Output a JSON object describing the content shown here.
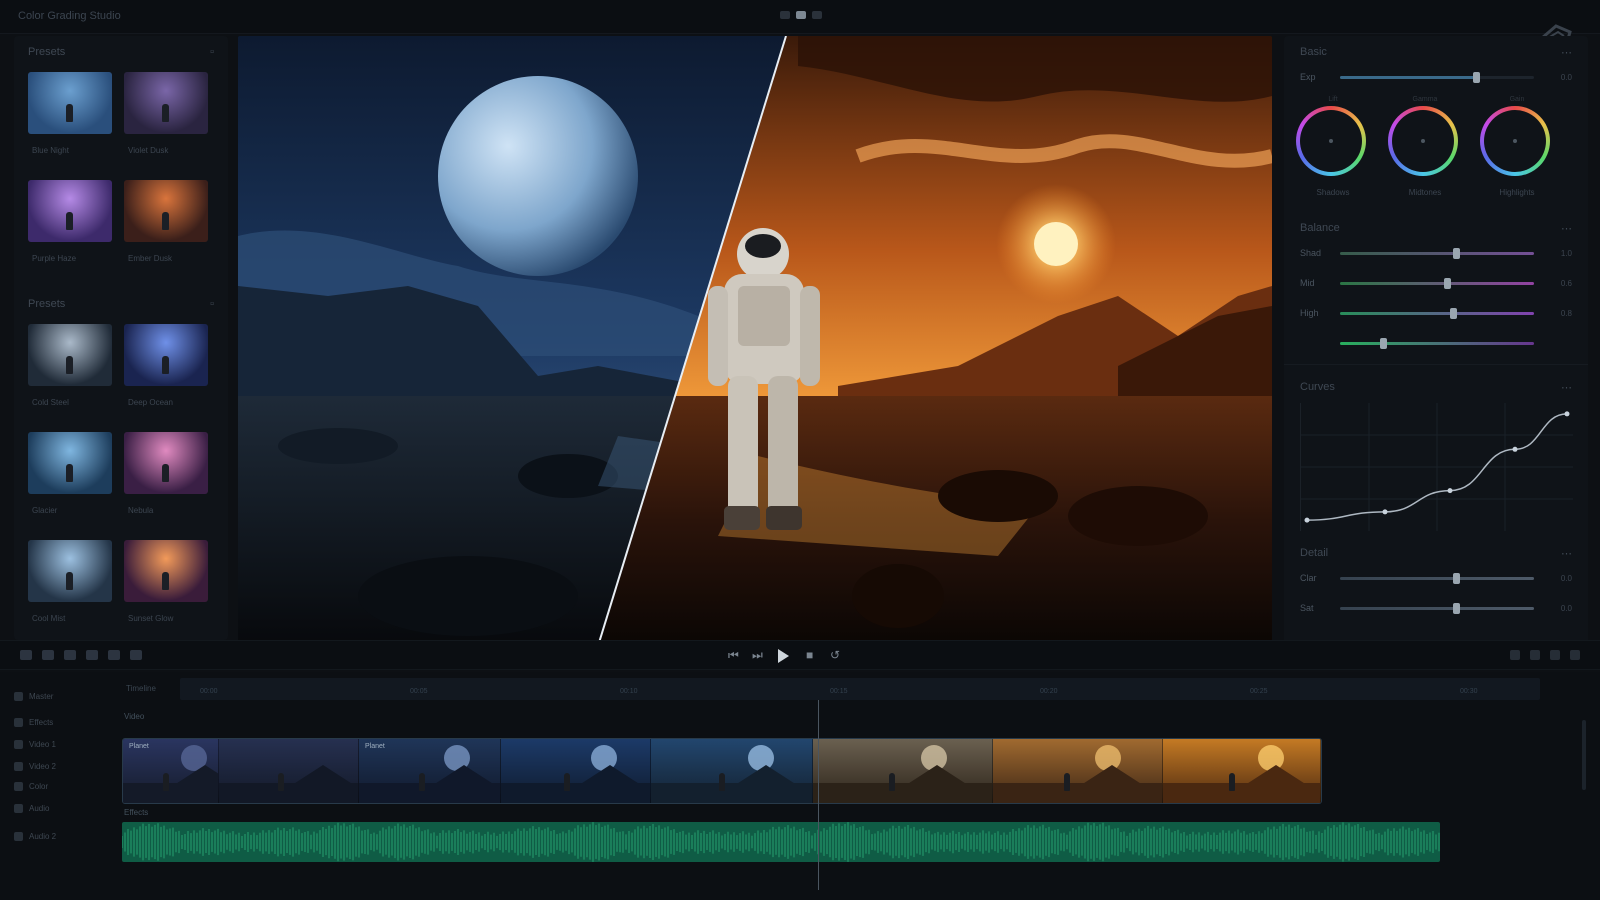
{
  "app": {
    "title": "Color Grading Studio",
    "view_modes": [
      "compare-split",
      "single",
      "side"
    ]
  },
  "left_panel": {
    "section1_title": "Presets",
    "section2_title": "Presets",
    "presets_top": [
      {
        "label": "Blue Night",
        "tint_a": "#2a4f7c",
        "tint_b": "#6b9fcf"
      },
      {
        "label": "Violet Dusk",
        "tint_a": "#2a2440",
        "tint_b": "#7a66a8"
      },
      {
        "label": "Purple Haze",
        "tint_a": "#3d2a6b",
        "tint_b": "#b58ae6"
      },
      {
        "label": "Ember Dusk",
        "tint_a": "#3b1f1a",
        "tint_b": "#d9743c"
      }
    ],
    "presets_bottom": [
      {
        "label": "Cold Steel",
        "tint_a": "#202b38",
        "tint_b": "#aab9c9"
      },
      {
        "label": "Deep Ocean",
        "tint_a": "#1a2450",
        "tint_b": "#6f90e8"
      },
      {
        "label": "Glacier",
        "tint_a": "#1d3d5c",
        "tint_b": "#7fb6e0"
      },
      {
        "label": "Nebula",
        "tint_a": "#3a1f45",
        "tint_b": "#e08ac0"
      },
      {
        "label": "Cool Mist",
        "tint_a": "#243548",
        "tint_b": "#9cc0e0"
      },
      {
        "label": "Sunset Glow",
        "tint_a": "#3a1c3a",
        "tint_b": "#f29a5a"
      }
    ]
  },
  "viewer": {
    "mode": "split-compare",
    "left_grade": "cool-night",
    "right_grade": "warm-sunset"
  },
  "right_panel": {
    "title": "Basic",
    "top_slider": {
      "label": "Exp",
      "value": 0.7,
      "value_text": "0.0"
    },
    "wheels": [
      {
        "top": "Lift",
        "label": "Shadows"
      },
      {
        "top": "Gamma",
        "label": "Midtones"
      },
      {
        "top": "Gain",
        "label": "Highlights"
      }
    ],
    "balance_title": "Balance",
    "balance_sliders": [
      {
        "label": "Shad",
        "value": 0.6,
        "value_text": "1.0",
        "colors": [
          "#3c6a52",
          "#8a5ab0"
        ]
      },
      {
        "label": "Mid",
        "value": 0.55,
        "value_text": "0.6",
        "colors": [
          "#2e8a4a",
          "#b04ac0"
        ]
      },
      {
        "label": "High",
        "value": 0.58,
        "value_text": "0.8",
        "colors": [
          "#2ba865",
          "#9a4ad0"
        ]
      },
      {
        "label": "",
        "value": 0.22,
        "value_text": "",
        "colors": [
          "#2bd26a",
          "#7a3aa8"
        ]
      }
    ],
    "curves_title": "Curves",
    "curve_points": [
      [
        0.0,
        0.05
      ],
      [
        0.3,
        0.12
      ],
      [
        0.55,
        0.3
      ],
      [
        0.8,
        0.65
      ],
      [
        1.0,
        0.95
      ]
    ],
    "detail_title": "Detail",
    "detail_sliders": [
      {
        "label": "Clar",
        "value": 0.6,
        "value_text": "0.0"
      },
      {
        "label": "Sat",
        "value": 0.6,
        "value_text": "0.0"
      }
    ]
  },
  "transport": {
    "buttons": [
      "prev-frame",
      "prev-clip",
      "play",
      "next-clip",
      "loop"
    ]
  },
  "timeline": {
    "track_names": [
      "Master",
      "Effects",
      "Video 1",
      "Video 2",
      "Color",
      "Audio",
      "Audio 2"
    ],
    "ruler_label": "Timeline",
    "ruler_marks": [
      "00:00",
      "00:05",
      "00:10",
      "00:15",
      "00:20",
      "00:25",
      "00:30"
    ],
    "video_label": "Video",
    "fx_label": "Effects",
    "clips": [
      {
        "label": "Planet",
        "width": 96,
        "sky": "#2a3560",
        "ground": "#141a28",
        "planet": "#5a6a9a"
      },
      {
        "label": "",
        "width": 140,
        "sky": "#263050",
        "ground": "#121826",
        "planet": ""
      },
      {
        "label": "Planet",
        "width": 142,
        "sky": "#1f3558",
        "ground": "#10182a",
        "planet": "#7d9bc8"
      },
      {
        "label": "",
        "width": 150,
        "sky": "#1c3a68",
        "ground": "#0f1a2c",
        "planet": "#8fb3de"
      },
      {
        "label": "",
        "width": 162,
        "sky": "#22466e",
        "ground": "#13202e",
        "planet": "#9ec3e8"
      },
      {
        "label": "",
        "width": 180,
        "sky": "#6a6050",
        "ground": "#2b2218",
        "planet": "#d8c8a8"
      },
      {
        "label": "",
        "width": 170,
        "sky": "#a06a30",
        "ground": "#3a2414",
        "planet": "#f0c070"
      },
      {
        "label": "",
        "width": 158,
        "sky": "#c47a24",
        "ground": "#4a2810",
        "planet": "#ffd070"
      }
    ],
    "audio_color": "#0f5c45"
  }
}
